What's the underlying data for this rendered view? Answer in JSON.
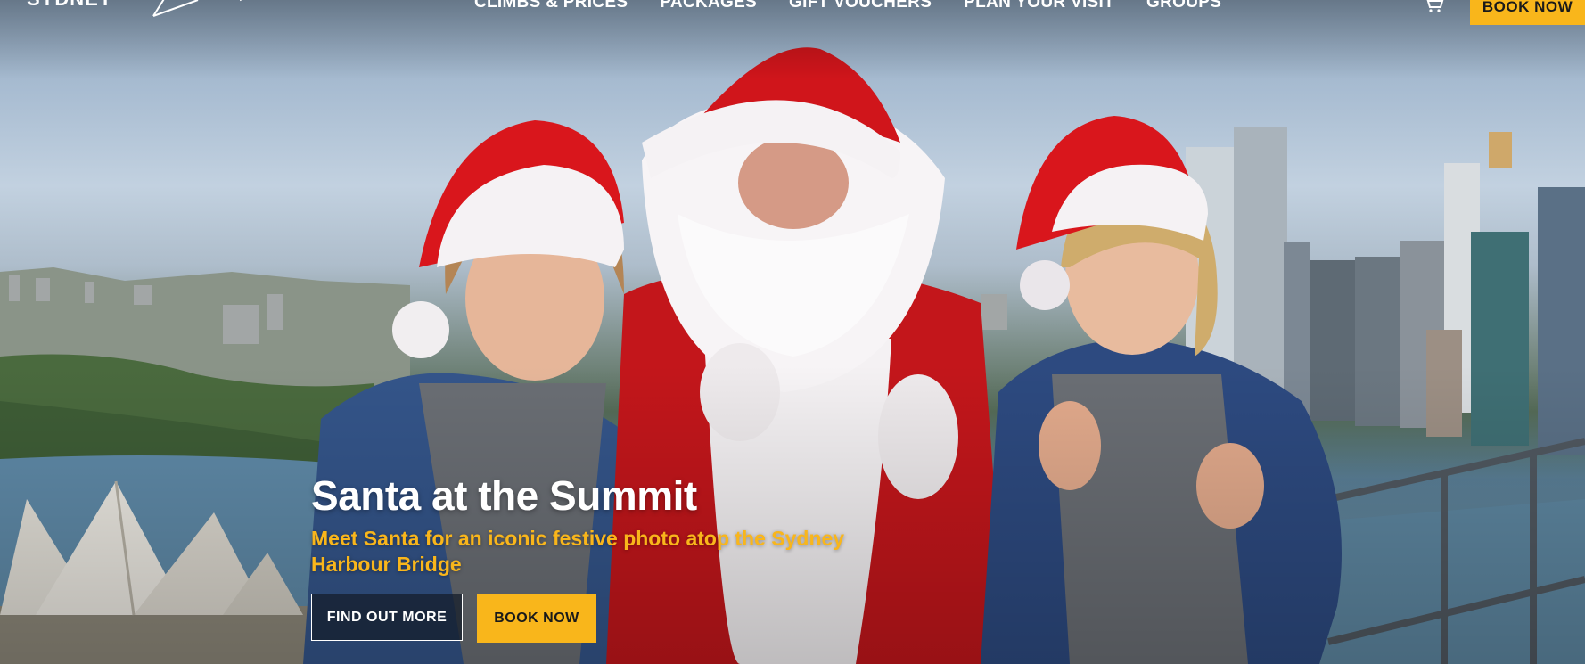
{
  "header": {
    "logo_text": "SYDNEY",
    "logo_icon": "bridge-logo-icon",
    "nav": [
      {
        "label": "CLIMBS & PRICES"
      },
      {
        "label": "PACKAGES"
      },
      {
        "label": "GIFT VOUCHERS"
      },
      {
        "label": "PLAN YOUR VISIT"
      },
      {
        "label": "GROUPS"
      }
    ],
    "cart_icon": "cart-icon",
    "book_label": "BOOK NOW"
  },
  "hero": {
    "image_description": "hero-photo",
    "title": "Santa at the Summit",
    "subtitle": "Meet Santa for an iconic festive photo atop the Sydney Harbour Bridge",
    "primary_button": "FIND OUT MORE",
    "secondary_button": "BOOK NOW"
  },
  "colors": {
    "accent": "#f9b61b",
    "text_light": "#ffffff",
    "button_dark": "#141c28"
  }
}
